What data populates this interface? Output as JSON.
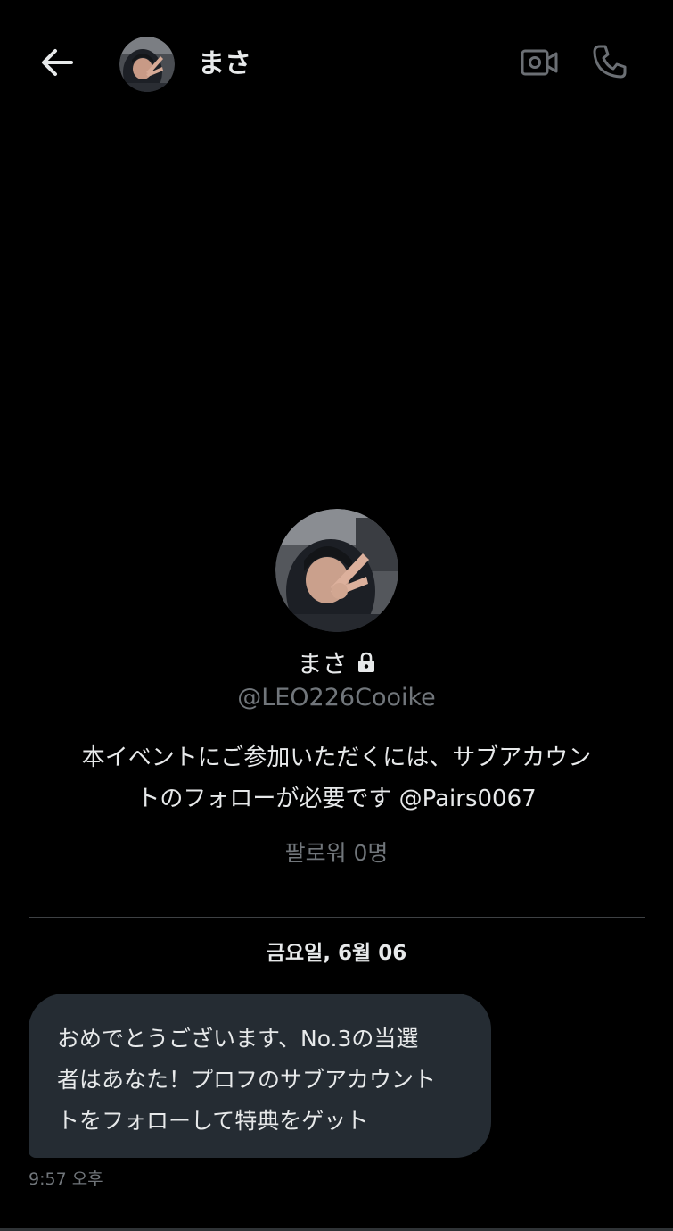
{
  "header": {
    "name": "まさ",
    "back_icon": "arrow-left-icon",
    "video_icon": "video-camera-icon",
    "call_icon": "phone-icon"
  },
  "profile": {
    "name": "まさ",
    "handle": "@LEO226Cooike",
    "bio_line1": "本イベントにご参加いただくには、サブアカウン",
    "bio_line2": "トのフォローが必要です @Pairs0067",
    "followers": "팔로워 0명",
    "lock_icon": "lock-icon"
  },
  "conversation": {
    "date": "금요일, 6월 06",
    "messages": [
      {
        "lines": [
          "おめでとうございます、No.3の当選",
          "者はあなた！プロフのサブアカウント",
          "トをフォローして特典をゲット"
        ],
        "time": "9:57 오후"
      }
    ]
  },
  "colors": {
    "background": "#000000",
    "text_primary": "#e7e9ea",
    "text_secondary": "#71767b",
    "bubble": "#252c33",
    "divider": "#3e4144"
  }
}
